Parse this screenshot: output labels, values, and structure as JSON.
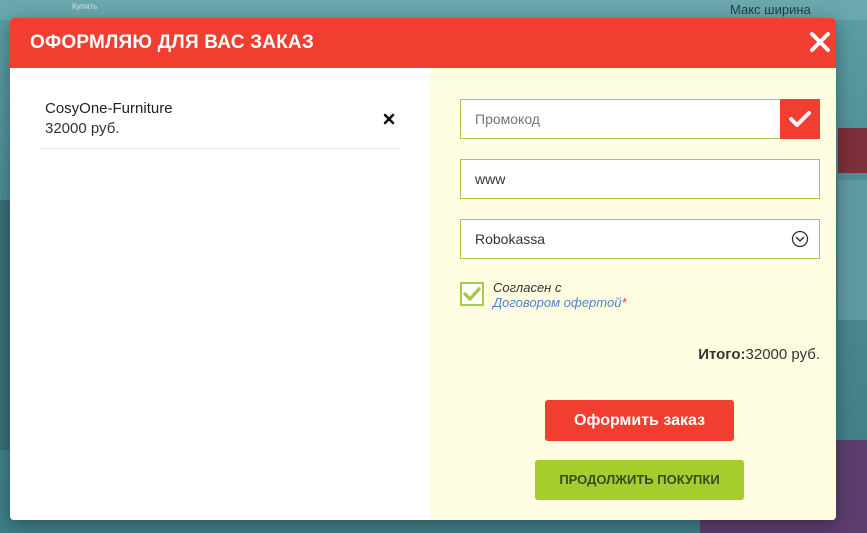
{
  "background": {
    "top_right_text": "Макс ширина",
    "buy_text": "Купить"
  },
  "modal": {
    "title": "ОФОРМЛЯЮ ДЛЯ ВАС ЗАКАЗ",
    "close_icon": "close-icon"
  },
  "cart": {
    "items": [
      {
        "name": "CosyOne-Furniture",
        "price": "32000 руб."
      }
    ]
  },
  "form": {
    "promo": {
      "placeholder": "Промокод",
      "value": ""
    },
    "www": {
      "value": "www"
    },
    "payment": {
      "selected": "Robokassa"
    },
    "agreement": {
      "checked": true,
      "text": "Согласен с",
      "link_text": "Договором офертой",
      "required_mark": "*"
    },
    "total": {
      "label": "Итого:",
      "value": "32000 руб."
    },
    "order_button": "Оформить заказ",
    "continue_button": "ПРОДОЛЖИТЬ ПОКУПКИ"
  },
  "colors": {
    "accent_red": "#f13e31",
    "accent_green": "#a4cd2d",
    "field_border": "#a9c94a",
    "right_pane_bg": "#fefde2",
    "link_blue": "#4f86c6"
  }
}
